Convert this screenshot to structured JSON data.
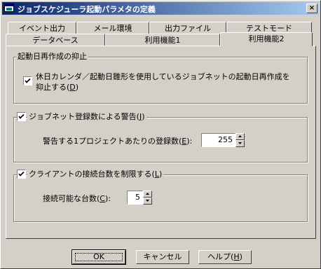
{
  "window": {
    "title": "ジョブスケジューラ起動パラメタの定義",
    "close_glyph": "×"
  },
  "tabs": {
    "row_back": [
      "イベント出力",
      "メール環境",
      "出力ファイル",
      "テストモード"
    ],
    "row_front": [
      "データベース",
      "利用機能1",
      "利用機能2"
    ],
    "active": "利用機能2"
  },
  "group1": {
    "title": "起動日再作成の抑止",
    "checkbox_checked": true,
    "checkbox_label_line1": "休日カレンダ／起動日雛形を使用しているジョブネットの起動日再作成を",
    "checkbox_label_line2": "抑止する(",
    "checkbox_label_access": "D",
    "checkbox_label_end": ")"
  },
  "group2": {
    "title_checkbox_checked": true,
    "title": "ジョブネット登録数による警告(",
    "title_access": "J",
    "title_end": ")",
    "field_label": "警告する1プロジェクトあたりの登録数(",
    "field_label_access": "E",
    "field_label_end": "):",
    "field_value": "255"
  },
  "group3": {
    "title_checkbox_checked": true,
    "title": "クライアントの接続台数を制限する(",
    "title_access": "L",
    "title_end": ")",
    "field_label": "接続可能な台数(",
    "field_label_access": "C",
    "field_label_end": "):",
    "field_value": "5"
  },
  "buttons": {
    "ok": "OK",
    "cancel": "キャンセル",
    "help": "ヘルプ(",
    "help_access": "H",
    "help_end": ")"
  }
}
